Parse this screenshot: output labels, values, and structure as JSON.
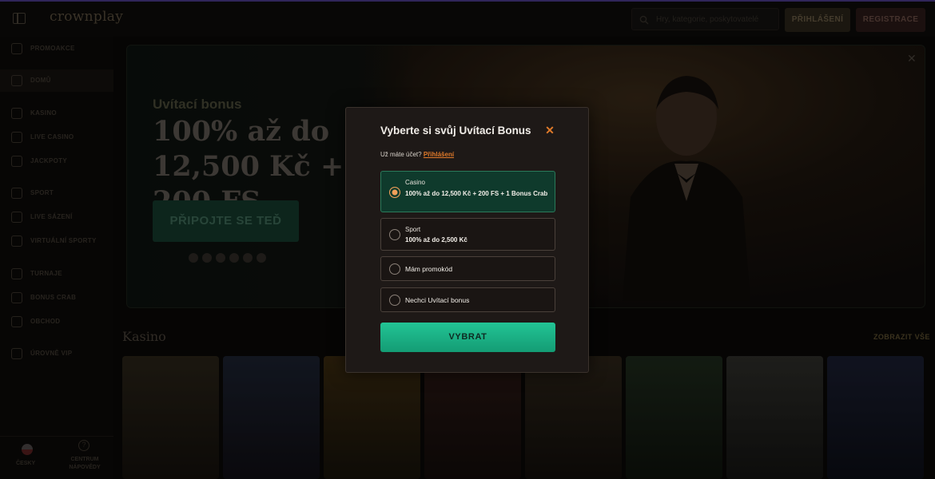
{
  "header": {
    "logo": "crownplay",
    "search_placeholder": "Hry, kategorie, poskytovatelé",
    "login_label": "PŘIHLÁŠENÍ",
    "register_label": "REGISTRACE"
  },
  "sidebar": {
    "items": [
      {
        "label": "PROMOAKCE",
        "icon": "gift-icon"
      },
      {
        "label": "DOMŮ",
        "icon": "home-icon"
      },
      {
        "label": "KASINO",
        "icon": "casino-icon"
      },
      {
        "label": "LIVE CASINO",
        "icon": "live-casino-icon"
      },
      {
        "label": "JACKPOTY",
        "icon": "jackpot-icon"
      },
      {
        "label": "SPORT",
        "icon": "football-icon"
      },
      {
        "label": "LIVE SÁZENÍ",
        "icon": "live-bet-icon"
      },
      {
        "label": "VIRTUÁLNÍ SPORTY",
        "icon": "virtual-sports-icon"
      },
      {
        "label": "TURNAJE",
        "icon": "trophy-icon"
      },
      {
        "label": "BONUS CRAB",
        "icon": "crab-icon"
      },
      {
        "label": "OBCHOD",
        "icon": "shop-icon"
      },
      {
        "label": "ÚROVNĚ VIP",
        "icon": "crown-icon"
      }
    ],
    "language": "ČESKY",
    "help": "CENTRUM NÁPOVĚDY"
  },
  "banner": {
    "subtitle": "Uvítací bonus",
    "headline": "100% až do 12,500 Kč + 200 FS",
    "cta": "PŘIPOJTE SE TEĎ"
  },
  "section": {
    "title": "Kasino",
    "show_all": "ZOBRAZIT VŠE"
  },
  "modal": {
    "title": "Vyberte si svůj Uvítací Bonus",
    "account_prefix": "Už máte účet?",
    "account_link": "Přihlášení",
    "options": [
      {
        "category": "Casino",
        "text": "100% až do 12,500 Kč + 200 FS + 1 Bonus Crab",
        "selected": true
      },
      {
        "category": "Sport",
        "text": "100% až do 2,500 Kč",
        "selected": false
      },
      {
        "category": "",
        "text": "Mám promokód",
        "selected": false
      },
      {
        "category": "",
        "text": "Nechci Uvítací bonus",
        "selected": false
      }
    ],
    "button": "VYBRAT"
  },
  "colors": {
    "accent_orange": "#e07a2a",
    "selected_green": "#0f3a2c",
    "button_green": "#1cb585"
  }
}
